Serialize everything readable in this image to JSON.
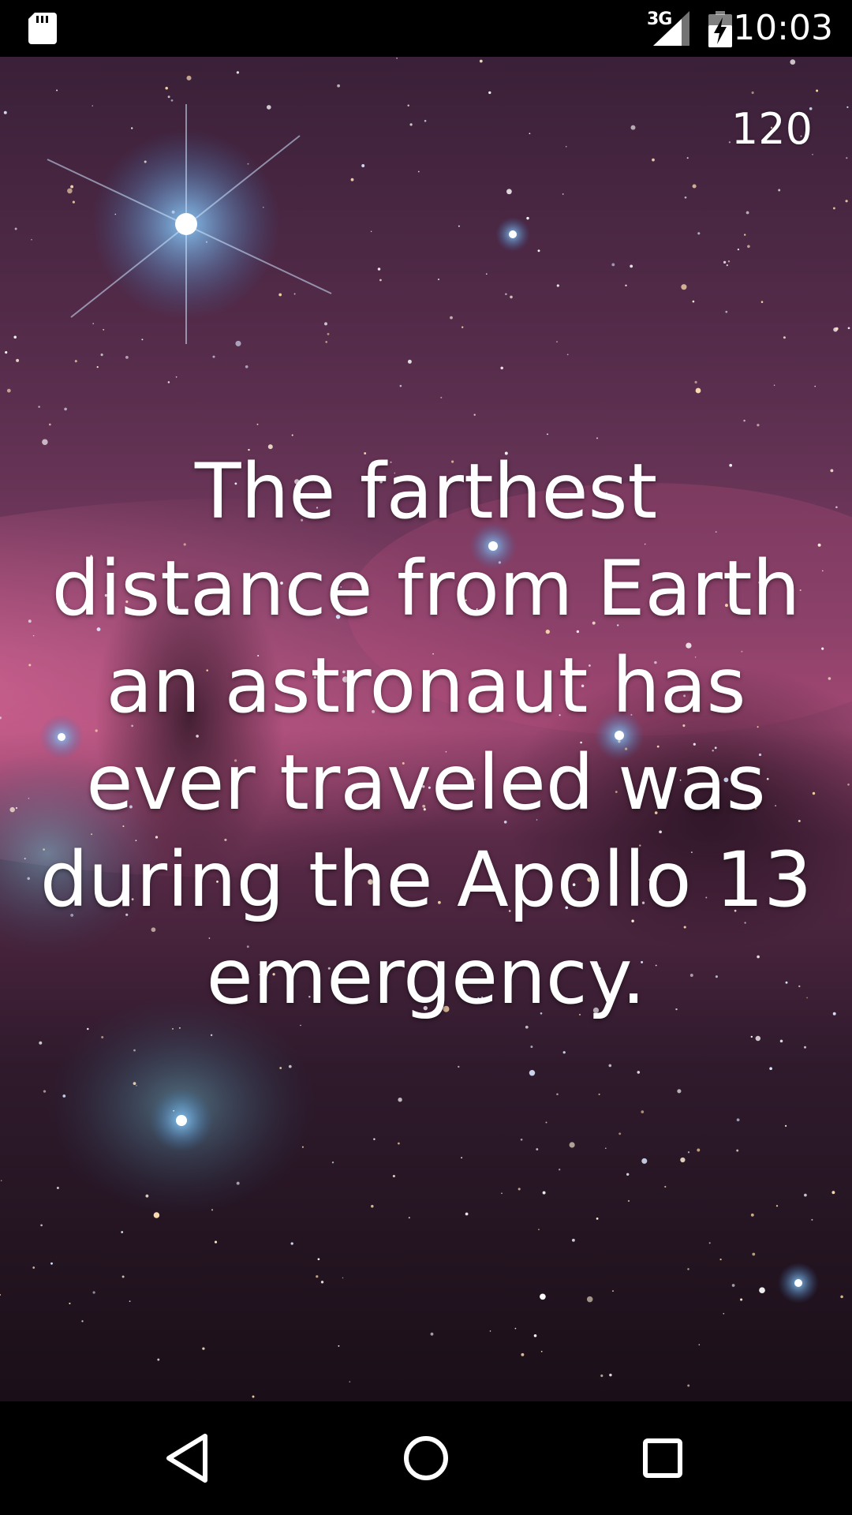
{
  "status_bar": {
    "network_type": "3G",
    "time": "10:03",
    "icons": [
      "sd-card-icon",
      "cell-signal-icon",
      "battery-charging-icon"
    ]
  },
  "fact": {
    "counter": "120",
    "text": "The farthest distance from Earth an astronaut has ever traveled was during the Apollo 13 emergency."
  },
  "nav_bar": {
    "icons": [
      "back-icon",
      "home-icon",
      "recents-icon"
    ]
  },
  "colors": {
    "status_bar_bg": "#000000",
    "nav_bar_bg": "#000000",
    "text": "#ffffff",
    "nebula_magenta": "#b04a78",
    "space_dark": "#1c0f1c"
  }
}
